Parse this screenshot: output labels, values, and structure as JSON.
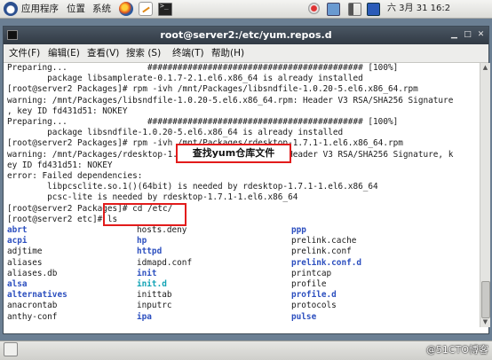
{
  "panel": {
    "menus": [
      "应用程序",
      "位置",
      "系统"
    ],
    "clock": "六 3月 31 16:2"
  },
  "window": {
    "title": "root@server2:/etc/yum.repos.d",
    "menu": [
      "文件(F)",
      "编辑(E)",
      "查看(V)",
      "搜索 (S)",
      "终端(T)",
      "帮助(H)"
    ]
  },
  "terminal": {
    "lines": [
      "Preparing...                ########################################### [100%]",
      "        package libsamplerate-0.1.7-2.1.el6.x86_64 is already installed",
      "[root@server2 Packages]# rpm -ivh /mnt/Packages/libsndfile-1.0.20-5.el6.x86_64.rpm",
      "warning: /mnt/Packages/libsndfile-1.0.20-5.el6.x86_64.rpm: Header V3 RSA/SHA256 Signature",
      ", key ID fd431d51: NOKEY",
      "Preparing...                ########################################### [100%]",
      "        package libsndfile-1.0.20-5.el6.x86_64 is already installed",
      "[root@server2 Packages]# rpm -ivh /mnt/Packages/rdesktop-1.7.1-1.el6.x86_64.rpm",
      "warning: /mnt/Packages/rdesktop-1.7.1-1.el6.x86_64.rpm: Header V3 RSA/SHA256 Signature, k",
      "ey ID fd431d51: NOKEY",
      "error: Failed dependencies:",
      "        libpcsclite.so.1()(64bit) is needed by rdesktop-1.7.1-1.el6.x86_64",
      "        pcsc-lite is needed by rdesktop-1.7.1-1.el6.x86_64",
      "[root@server2 Packages]# cd /etc/",
      "[root@server2 etc]# ls"
    ],
    "ls_columns": [
      [
        {
          "name": "abrt",
          "c": "blue"
        },
        {
          "name": "acpi",
          "c": "blue"
        },
        {
          "name": "adjtime",
          "c": "plain"
        },
        {
          "name": "aliases",
          "c": "plain"
        },
        {
          "name": "aliases.db",
          "c": "plain"
        },
        {
          "name": "alsa",
          "c": "blue"
        },
        {
          "name": "alternatives",
          "c": "blue"
        },
        {
          "name": "anacrontab",
          "c": "plain"
        },
        {
          "name": "anthy-conf",
          "c": "plain"
        }
      ],
      [
        {
          "name": "hosts.deny",
          "c": "plain"
        },
        {
          "name": "hp",
          "c": "blue"
        },
        {
          "name": "httpd",
          "c": "blue"
        },
        {
          "name": "idmapd.conf",
          "c": "plain"
        },
        {
          "name": "init",
          "c": "blue"
        },
        {
          "name": "init.d",
          "c": "cyan"
        },
        {
          "name": "inittab",
          "c": "plain"
        },
        {
          "name": "inputrc",
          "c": "plain"
        },
        {
          "name": "ipa",
          "c": "blue"
        }
      ],
      [
        {
          "name": "ppp",
          "c": "blue"
        },
        {
          "name": "prelink.cache",
          "c": "plain"
        },
        {
          "name": "prelink.conf",
          "c": "plain"
        },
        {
          "name": "prelink.conf.d",
          "c": "blue"
        },
        {
          "name": "printcap",
          "c": "plain"
        },
        {
          "name": "profile",
          "c": "plain"
        },
        {
          "name": "profile.d",
          "c": "blue"
        },
        {
          "name": "protocols",
          "c": "plain"
        },
        {
          "name": "pulse",
          "c": "blue"
        }
      ]
    ]
  },
  "annotation": {
    "callout_text": "查找yum仓库文件",
    "accent": "#e21b1b"
  },
  "watermark": "@51CTO博客"
}
